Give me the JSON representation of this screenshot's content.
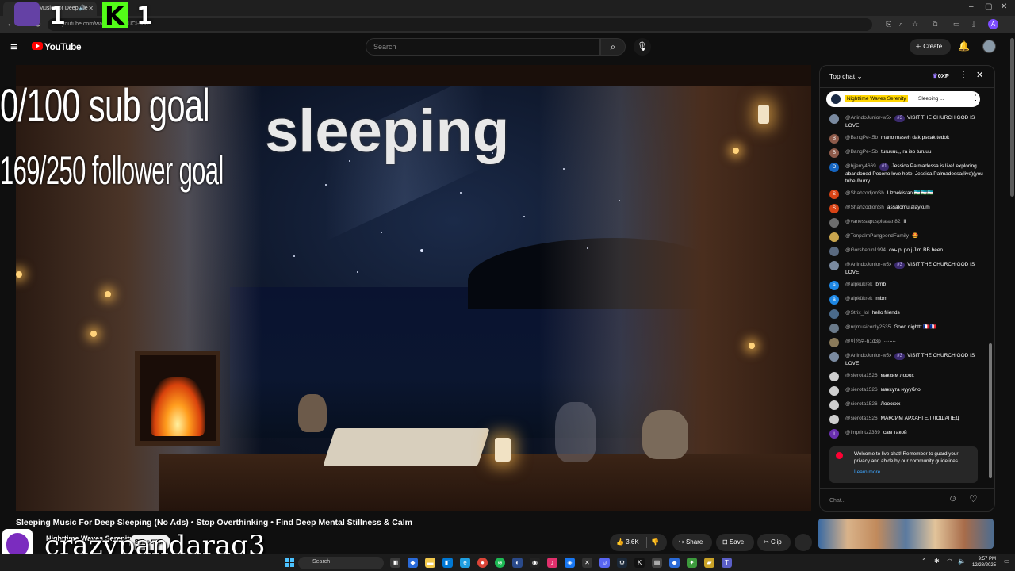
{
  "browser": {
    "tab_title": "Sleeping Music For Deep Sle",
    "url": "youtube.com/wa",
    "url_tail": "UCI-so6"
  },
  "overlay": {
    "twitch_count": "1",
    "kick_count": "1",
    "kick_letter": "K",
    "sub_goal": "0/100 sub goal",
    "follower_goal": "169/250 follower goal",
    "status": "sleeping",
    "handle": "crazypandarag3"
  },
  "header": {
    "logo_text": "YouTube",
    "search_placeholder": "Search",
    "create_label": "Create"
  },
  "video": {
    "title": "Sleeping Music For Deep Sleeping (No Ads) • Stop Overthinking • Find Deep Mental Stillness & Calm",
    "channel_name": "Nighttime Waves Serenity",
    "subscribe_label": "Subscribe",
    "actions": {
      "likes": "3.6K",
      "share": "Share",
      "save": "Save",
      "clip": "Clip"
    }
  },
  "chat": {
    "header_label": "Top chat",
    "xp_label": "0XP",
    "pinned": {
      "name": "Nighttime Waves Serenity",
      "text": "Sleeping ..."
    },
    "messages": [
      {
        "author": "@ArlindoJunior-w5x",
        "badge": "#3",
        "text": "VISIT THE CHURCH GOD IS LOVE",
        "color": "#7a8aa0",
        "initial": ""
      },
      {
        "author": "@BangPe-t5b",
        "badge": "",
        "text": "mano maseh dak pscak tedok",
        "color": "#8d5a4a",
        "initial": "B"
      },
      {
        "author": "@BangPe-t5b",
        "badge": "",
        "text": "turuuuu,, ra iso turuuu",
        "color": "#8d5a4a",
        "initial": "B"
      },
      {
        "author": "@bjjerry4669",
        "badge": "#1",
        "text": "Jessica Palmadessa is live! exploring abandoned Pocono love hotel Jessica Palmadessa(live)(you tube /hurry",
        "color": "#1565c0",
        "initial": "O"
      },
      {
        "author": "@ShahzodjonSh",
        "badge": "",
        "text": "Uzbekistan 🇺🇿🇺🇿🇺🇿",
        "color": "#d84315",
        "initial": "S"
      },
      {
        "author": "@ShahzodjonSh",
        "badge": "",
        "text": "assalomu alaykum",
        "color": "#d84315",
        "initial": "S"
      },
      {
        "author": "@vanessapuspitasari82",
        "badge": "",
        "text": "il",
        "color": "#6d6d6d",
        "initial": ""
      },
      {
        "author": "@TonpalmPangpondFamily",
        "badge": "",
        "text": "🤩",
        "color": "#c9a54e",
        "initial": ""
      },
      {
        "author": "@Gorshenin1994",
        "badge": "",
        "text": "охь рі ро j Jim BB been",
        "color": "#5a6a80",
        "initial": ""
      },
      {
        "author": "@ArlindoJunior-w5x",
        "badge": "#3",
        "text": "VISIT THE CHURCH GOD IS LOVE",
        "color": "#7a8aa0",
        "initial": ""
      },
      {
        "author": "@alpkükrek",
        "badge": "",
        "text": "bmb",
        "color": "#1e88e5",
        "initial": "a"
      },
      {
        "author": "@alpkükrek",
        "badge": "",
        "text": "mbm",
        "color": "#1e88e5",
        "initial": "a"
      },
      {
        "author": "@Strix_lol",
        "badge": "",
        "text": "hello friends",
        "color": "#4a6a8a",
        "initial": ""
      },
      {
        "author": "@nrjmusiconly2535",
        "badge": "",
        "text": "Good nighttt 🇫🇷🇫🇷",
        "color": "#6a7a8a",
        "initial": ""
      },
      {
        "author": "@이승준-h1d3p",
        "badge": "",
        "text": "·······",
        "color": "#8a7a5a",
        "initial": ""
      },
      {
        "author": "@ArlindoJunior-w5x",
        "badge": "#3",
        "text": "VISIT THE CHURCH GOD IS LOVE",
        "color": "#7a8aa0",
        "initial": ""
      },
      {
        "author": "@sierota1526",
        "badge": "",
        "text": "максим лоооx",
        "color": "#cfcfcf",
        "initial": ""
      },
      {
        "author": "@sierota1526",
        "badge": "",
        "text": "максута нууубло",
        "color": "#cfcfcf",
        "initial": ""
      },
      {
        "author": "@sierota1526",
        "badge": "",
        "text": "Лоооххх",
        "color": "#cfcfcf",
        "initial": ""
      },
      {
        "author": "@sierota1526",
        "badge": "",
        "text": "МАКСИМ АРХАНГЕЛ ЛОШАПЕД",
        "color": "#cfcfcf",
        "initial": ""
      },
      {
        "author": "@imprintz2369",
        "badge": "",
        "text": "сам такой",
        "color": "#6a2fb0",
        "initial": "i"
      }
    ],
    "welcome_text": "Welcome to live chat! Remember to guard your privacy and abide by our community guidelines.",
    "learn_more": "Learn more",
    "input_placeholder": "Chat..."
  },
  "taskbar": {
    "search_label": "Search",
    "time": "9:57 PM",
    "date": "12/28/2025"
  },
  "colors": {
    "youtube_red": "#ff0000",
    "kick_green": "#53fc18",
    "twitch_purple": "#6441a5",
    "pinned_highlight": "#ffd600"
  }
}
